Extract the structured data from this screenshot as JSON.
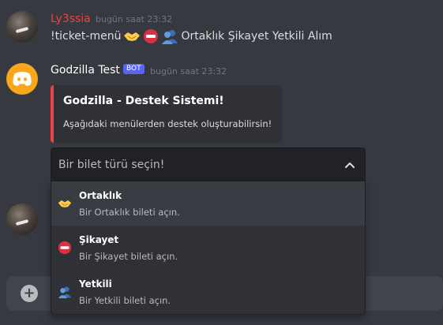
{
  "messages": [
    {
      "username": "Ly3ssia",
      "username_color": "#ed4245",
      "timestamp": "bugün saat 23:32",
      "content_prefix": "!ticket-menü",
      "content_suffix": "Ortaklık Şikayet Yetkili Alım"
    },
    {
      "username": "Godzilla Test",
      "username_color": "#ffffff",
      "bot_badge": "BOT",
      "timestamp": "bugün saat 23:32",
      "embed": {
        "title": "Godzilla - Destek Sistemi!",
        "description": "Aşağıdaki menülerden destek oluşturabilirsin!",
        "color": "#ed4245"
      }
    }
  ],
  "select_menu": {
    "placeholder": "Bir bilet türü seçin!",
    "options": [
      {
        "label": "Ortaklık",
        "description": "Bir Ortaklık bileti açın.",
        "icon": "handshake-icon"
      },
      {
        "label": "Şikayet",
        "description": "Bir Şikayet bileti açın.",
        "icon": "no-entry-icon"
      },
      {
        "label": "Yetkili",
        "description": "Bir Yetkili bileti açın.",
        "icon": "busts-icon"
      }
    ]
  },
  "colors": {
    "background": "#36393f",
    "accent": "#5865f2",
    "bot_avatar": "#faa61a"
  }
}
